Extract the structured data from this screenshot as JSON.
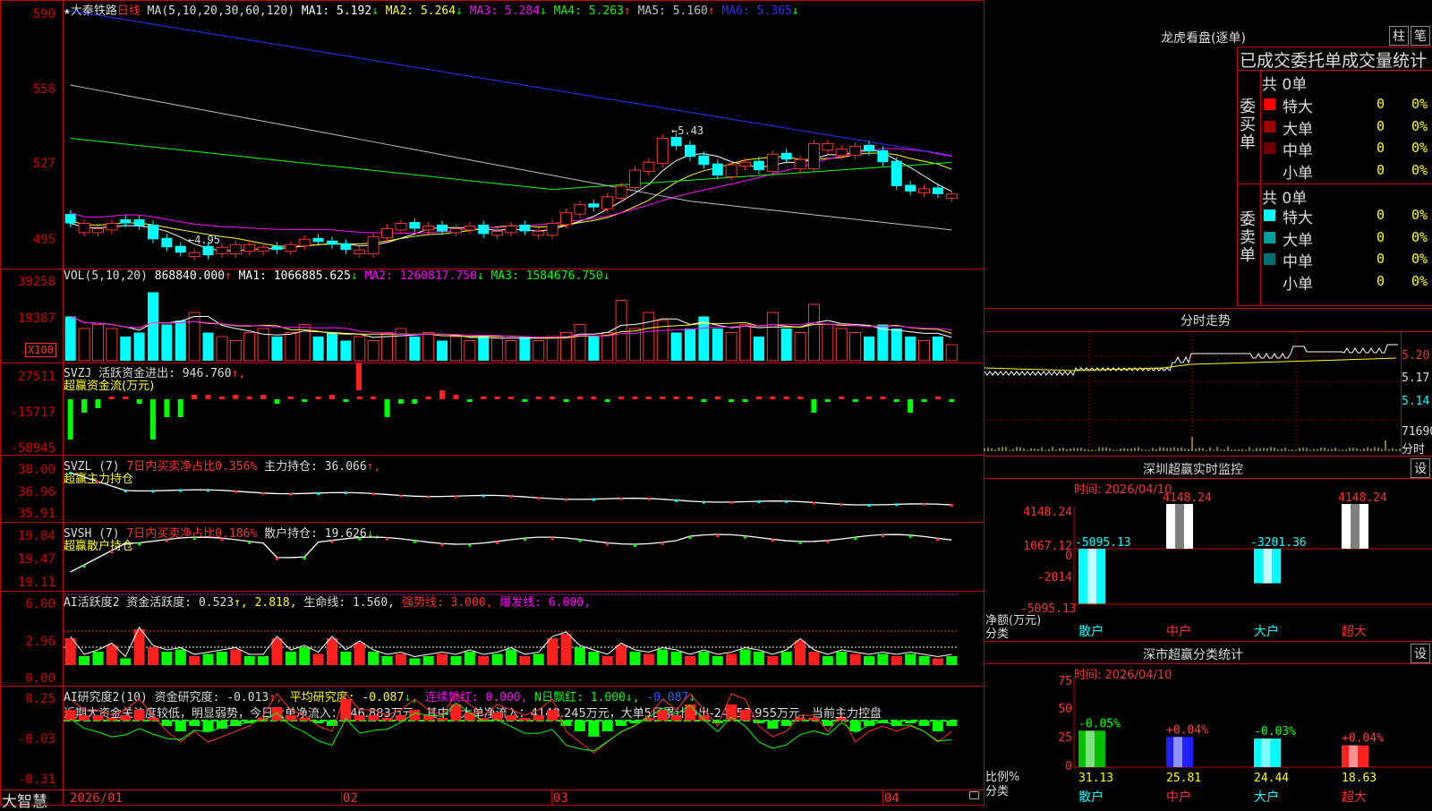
{
  "main": {
    "kline_title": "★大秦铁路",
    "period": "日线",
    "ma_header": "MA(5,10,20,30,60,120)",
    "ma_values": [
      {
        "label": "MA1: 5.192",
        "arrow": "↓",
        "color": "#ffffff"
      },
      {
        "label": "MA2: 5.264",
        "arrow": "↓",
        "color": "#ffff00"
      },
      {
        "label": "MA3: 5.284",
        "arrow": "↓",
        "color": "#ff00ff"
      },
      {
        "label": "MA4: 5.263",
        "arrow": "↑",
        "color": "#00ff00"
      },
      {
        "label": "MA5: 5.160",
        "arrow": "↑",
        "color": "#c0c0c0"
      },
      {
        "label": "MA6: 5.365",
        "arrow": "↓",
        "color": "#3030ff"
      }
    ],
    "price_axis": [
      "590",
      "558",
      "527",
      "495"
    ],
    "high_mark": "←5.43",
    "low_mark": "←4.95",
    "vol_header": "VOL(5,10,20)",
    "vol_values": [
      {
        "label": "868840.000",
        "arrow": "↑",
        "color": "#ffffff"
      },
      {
        "label": "MA1: 1066885.625",
        "arrow": "↓",
        "color": "#ffffff"
      },
      {
        "label": "MA2: 1260817.750",
        "arrow": "↓",
        "color": "#ff00ff"
      },
      {
        "label": "MA3: 1584676.750",
        "arrow": "↓",
        "color": "#00ff00"
      }
    ],
    "vol_axis": [
      "39258",
      "19387"
    ],
    "vol_unit": "X100",
    "svzj_header": "SVZJ  活跃资金进出: 946.760",
    "svzj_arrow": "↑,",
    "svzj_sub": "超赢资金流(万元)",
    "svzj_axis": [
      "27511",
      "-15717",
      "-58945"
    ],
    "svzl_header": "SVZL (7)",
    "svzl_ratio": "7日内买卖净占比0.356%",
    "svzl_hold": "主力持仓: 36.066",
    "svzl_arrow": "↑,",
    "svzl_sub": "超赢主力持仓",
    "svzl_axis": [
      "38.00",
      "36.96",
      "35.91"
    ],
    "svsh_header": "SVSH (7)",
    "svsh_ratio": "7日内买卖净占比0.186%",
    "svsh_hold": "散户持仓: 19.626",
    "svsh_arrow": "↓,",
    "svsh_sub": "超赢散户持仓",
    "svsh_axis": [
      "19.84",
      "19.47",
      "19.11"
    ],
    "ai1_header": "AI活跃度2 资金活跃度: 0.523",
    "ai1_a": "↑, 2.818,",
    "ai1_b": "生命线: 1.560,",
    "ai1_c": "强势线: 3.000,",
    "ai1_d": "爆发线: 6.000,",
    "ai1_axis": [
      "6.00",
      "2.96",
      "0.00"
    ],
    "ai2_header": "AI研究度2(10) 资金研究度: -0.013",
    "ai2_a": "↑,",
    "ai2_b": "平均研究度: -0.087",
    "ai2_c": "↓,",
    "ai2_d": "连续飘红: 0.000,",
    "ai2_e": "N日飘红: 1.000",
    "ai2_f": "↓,",
    "ai2_g": "-0.087",
    "ai2_h": "↓",
    "ai2_comment": "近期大资金关注度较低，明显弱势，今日大单净流入：946.883万元，其中特大单净流入：4148.245万元，大单5日累计净出-24657.955万元，当前主力控盘",
    "ai2_axis": [
      "0.25",
      "-0.03",
      "-0.31"
    ],
    "date_labels": [
      "2026/01",
      "02",
      "03",
      "04"
    ],
    "brand": "大智慧"
  },
  "right": {
    "lhkp_title": "龙虎看盘(逐单)",
    "btn_zhu": "柱",
    "btn_bi": "笔",
    "tabs_line": "已成交委托单成交量统计",
    "buy_label": "委买单",
    "sell_label": "委卖单",
    "buy_total": "共 0单",
    "sell_total": "共 0单",
    "buy_rows": [
      {
        "name": "特大",
        "count": "0",
        "pct": "0%",
        "color": "#ff0000"
      },
      {
        "name": "大单",
        "count": "0",
        "pct": "0%",
        "color": "#a00000"
      },
      {
        "name": "中单",
        "count": "0",
        "pct": "0%",
        "color": "#700000"
      },
      {
        "name": "小单",
        "count": "0",
        "pct": "0%",
        "color": ""
      }
    ],
    "sell_rows": [
      {
        "name": "特大",
        "count": "0",
        "pct": "0%",
        "color": "#00ffff"
      },
      {
        "name": "大单",
        "count": "0",
        "pct": "0%",
        "color": "#00a0a0"
      },
      {
        "name": "中单",
        "count": "0",
        "pct": "0%",
        "color": "#007070"
      },
      {
        "name": "小单",
        "count": "0",
        "pct": "0%",
        "color": ""
      }
    ],
    "fenshi_title": "分时走势",
    "fenshi_prices": [
      "5.20",
      "5.17",
      "5.14"
    ],
    "fenshi_vol": [
      "71690",
      "分时"
    ],
    "sz_title": "深圳超赢实时监控",
    "sz_btn": "设",
    "sz_time": "时间: 2026/04/10",
    "sz_axis": [
      "4148.24",
      "1067.12",
      "0",
      "-2014",
      "-5095.13"
    ],
    "sz_ylabel": "净额(万元)",
    "sz_xlabel": "分类",
    "sz_cats": [
      "散户",
      "中户",
      "大户",
      "超大"
    ],
    "sz_bars": [
      {
        "value": -5095.13,
        "label": "-5095.13"
      },
      {
        "value": 4148.24,
        "label": "4148.24"
      },
      {
        "value": -3201.36,
        "label": "-3201.36"
      },
      {
        "value": 4148.24,
        "label": "4148.24"
      }
    ],
    "fl_title": "深市超赢分类统计",
    "fl_btn": "设",
    "fl_time": "时间: 2026/04/10",
    "fl_axis": [
      "75",
      "50",
      "25",
      "0"
    ],
    "fl_ylabel": "比例%",
    "fl_xlabel": "分类",
    "fl_cats": [
      "散户",
      "中户",
      "大户",
      "超大"
    ],
    "fl_bars": [
      {
        "value": 31.13,
        "label": "31.13",
        "delta": "-0.05%",
        "color": "#00c000",
        "dcolor": "#00ff00"
      },
      {
        "value": 25.81,
        "label": "25.81",
        "delta": "+0.04%",
        "color": "#2020ff",
        "dcolor": "#ff4040"
      },
      {
        "value": 24.44,
        "label": "24.44",
        "delta": "-0.03%",
        "color": "#00ffff",
        "dcolor": "#00ff00"
      },
      {
        "value": 18.63,
        "label": "18.63",
        "delta": "+0.04%",
        "color": "#ff2020",
        "dcolor": "#ff4040"
      }
    ]
  },
  "chart_data": {
    "type": "candlestick",
    "title": "大秦铁路 日线",
    "x_labels": [
      "2026/01",
      "02",
      "03",
      "04"
    ],
    "ylim": [
      4.91,
      5.92
    ],
    "high_label": 5.43,
    "low_label": 4.95,
    "close": [
      5.08,
      5.05,
      5.06,
      5.08,
      5.09,
      5.07,
      5.02,
      4.99,
      4.97,
      4.96,
      4.99,
      4.97,
      5.0,
      4.98,
      4.99,
      4.98,
      5.0,
      5.02,
      5.01,
      5.0,
      4.98,
      4.97,
      5.03,
      5.06,
      5.08,
      5.06,
      5.07,
      5.05,
      5.06,
      5.07,
      5.04,
      5.05,
      5.07,
      5.05,
      5.04,
      5.08,
      5.12,
      5.15,
      5.14,
      5.18,
      5.22,
      5.28,
      5.31,
      5.4,
      5.37,
      5.33,
      5.3,
      5.26,
      5.3,
      5.31,
      5.28,
      5.34,
      5.32,
      5.29,
      5.38,
      5.36,
      5.34,
      5.37,
      5.35,
      5.31,
      5.22,
      5.2,
      5.21,
      5.19,
      5.18
    ],
    "colors": [
      "#00ffff",
      "#ff3232",
      "#ff3232",
      "#ff3232",
      "#00ffff",
      "#00ffff",
      "#00ffff",
      "#00ffff",
      "#00ffff",
      "#ff3232",
      "#00ffff",
      "#ff3232",
      "#ff3232",
      "#ff3232",
      "#ff3232",
      "#00ffff",
      "#ff3232",
      "#ff3232",
      "#00ffff",
      "#00ffff",
      "#00ffff",
      "#ff3232",
      "#ff3232",
      "#ff3232",
      "#ff3232",
      "#00ffff",
      "#ff3232",
      "#00ffff",
      "#ff3232",
      "#ff3232",
      "#00ffff",
      "#ff3232",
      "#ff3232",
      "#00ffff",
      "#ff3232",
      "#ff3232",
      "#ff3232",
      "#ff3232",
      "#00ffff",
      "#ff3232",
      "#ff3232",
      "#ff3232",
      "#ff3232",
      "#ff3232",
      "#00ffff",
      "#00ffff",
      "#00ffff",
      "#00ffff",
      "#ff3232",
      "#ff3232",
      "#00ffff",
      "#ff3232",
      "#00ffff",
      "#ff3232",
      "#ff3232",
      "#ff3232",
      "#ff3232",
      "#ff3232",
      "#00ffff",
      "#00ffff",
      "#00ffff",
      "#00ffff",
      "#ff3232",
      "#00ffff",
      "#ff3232"
    ],
    "volume_axis": [
      19387,
      39258
    ]
  }
}
